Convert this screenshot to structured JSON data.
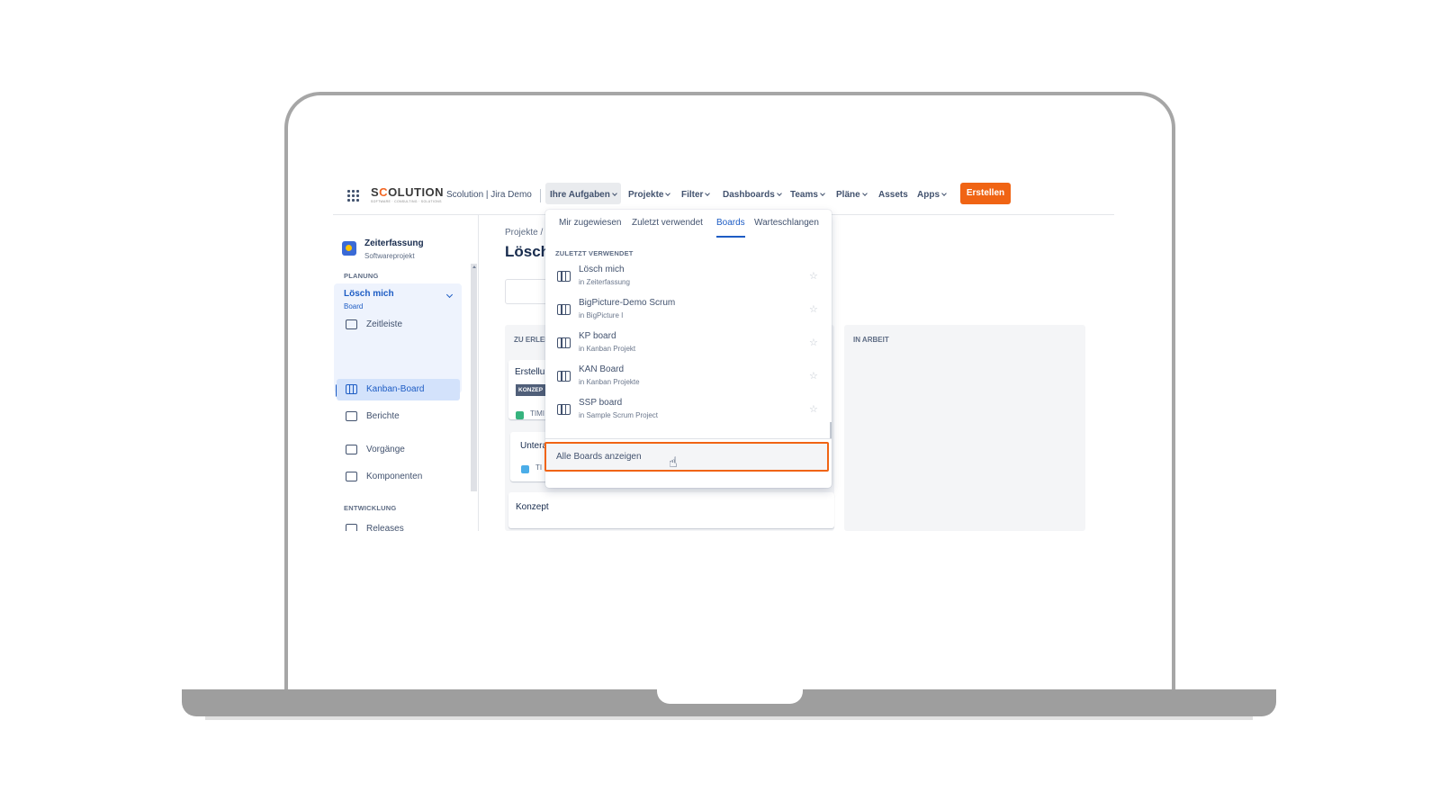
{
  "topnav": {
    "logo": "SCOLUTION",
    "logo_sub": "SOFTWARE · CONSULTING · SOLUTIONS",
    "site": "Scolution | Jira Demo",
    "items": [
      {
        "label": "Ihre Aufgaben"
      },
      {
        "label": "Projekte"
      },
      {
        "label": "Filter"
      },
      {
        "label": "Dashboards"
      },
      {
        "label": "Teams"
      },
      {
        "label": "Pläne"
      },
      {
        "label": "Assets"
      },
      {
        "label": "Apps"
      }
    ],
    "create_label": "Erstellen"
  },
  "sidebar": {
    "project_name": "Zeiterfassung",
    "project_type": "Softwareprojekt",
    "planning_label": "PLANUNG",
    "board_selector": {
      "name": "Lösch mich",
      "type": "Board"
    },
    "items": [
      {
        "label": "Zeitleiste"
      },
      {
        "label": "Kanban-Board"
      },
      {
        "label": "Berichte"
      },
      {
        "label": "Vorgänge"
      },
      {
        "label": "Komponenten"
      }
    ],
    "development_label": "ENTWICKLUNG",
    "dev_items": [
      {
        "label": "Releases"
      }
    ]
  },
  "main": {
    "breadcrumb": "Projekte  /",
    "title": "Lösch",
    "columns": [
      {
        "title": "ZU ERLED"
      },
      {
        "title": "IN ARBEIT"
      }
    ],
    "cards": [
      {
        "title": "Erstellun",
        "badge": "KONZEP",
        "key": "TIMI"
      },
      {
        "title": "Untera",
        "key": "TI"
      },
      {
        "title": "Konzept"
      }
    ]
  },
  "dropdown": {
    "tabs": [
      {
        "label": "Mir zugewiesen"
      },
      {
        "label": "Zuletzt verwendet"
      },
      {
        "label": "Boards"
      },
      {
        "label": "Warteschlangen"
      }
    ],
    "active_tab": "Boards",
    "section_label": "ZULETZT VERWENDET",
    "items": [
      {
        "name": "Lösch mich",
        "location": "in Zeiterfassung"
      },
      {
        "name": "BigPicture-Demo Scrum",
        "location": "in BigPicture I"
      },
      {
        "name": "KP board",
        "location": "in Kanban Projekt"
      },
      {
        "name": "KAN Board",
        "location": "in Kanban Projekte"
      },
      {
        "name": "SSP board",
        "location": "in Sample Scrum Project"
      }
    ],
    "all_boards_label": "Alle Boards anzeigen"
  },
  "colors": {
    "accent": "#1d5cc4",
    "create_button": "#f06414",
    "highlight_border": "#f06414"
  }
}
